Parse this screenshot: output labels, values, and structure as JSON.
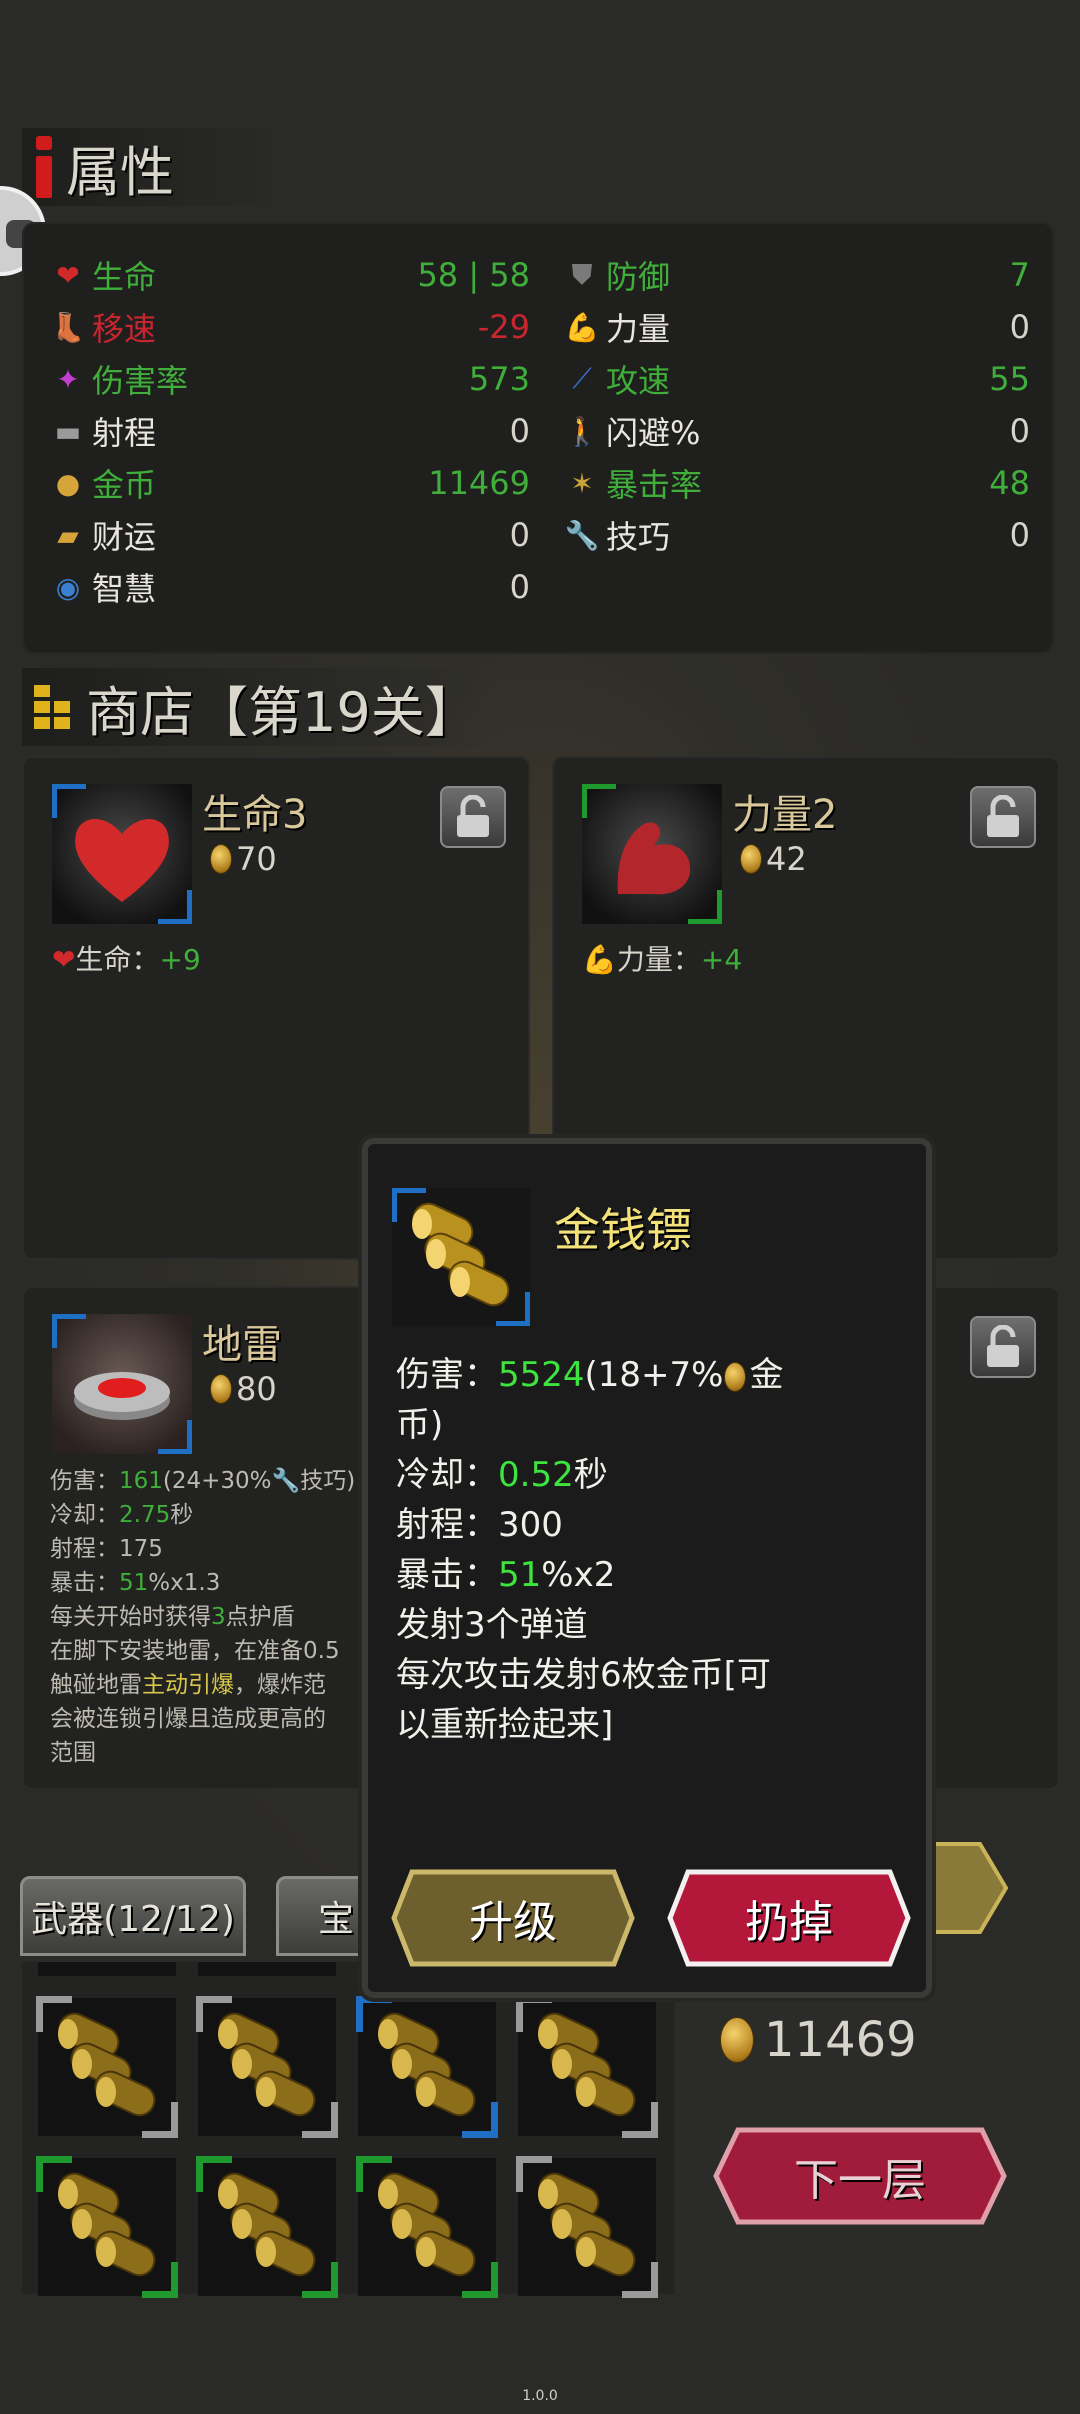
{
  "attributes": {
    "title": "属性",
    "stats_left": [
      {
        "icon": "heart-icon",
        "label": "生命",
        "value": "58 | 58",
        "color": "#3fae3a"
      },
      {
        "icon": "boot-icon",
        "label": "移速",
        "value": "-29",
        "color": "#c8262f"
      },
      {
        "icon": "sparkle-icon",
        "label": "伤害率",
        "value": "573",
        "color": "#3fae3a"
      },
      {
        "icon": "ruler-icon",
        "label": "射程",
        "value": "0",
        "color": "#d7d4cb"
      },
      {
        "icon": "coin-icon",
        "label": "金币",
        "value": "11469",
        "color": "#3fae3a"
      },
      {
        "icon": "gold-ingot-icon",
        "label": "财运",
        "value": "0",
        "color": "#d7d4cb"
      },
      {
        "icon": "brain-icon",
        "label": "智慧",
        "value": "0",
        "color": "#d7d4cb"
      }
    ],
    "stats_right": [
      {
        "icon": "shield-icon",
        "label": "防御",
        "value": "7",
        "color": "#3fae3a"
      },
      {
        "icon": "muscle-icon",
        "label": "力量",
        "value": "0",
        "color": "#d7d4cb"
      },
      {
        "icon": "feather-icon",
        "label": "攻速",
        "value": "55",
        "color": "#3fae3a"
      },
      {
        "icon": "dodge-figure-icon",
        "label": "闪避%",
        "value": "0",
        "color": "#d7d4cb"
      },
      {
        "icon": "crit-star-icon",
        "label": "暴击率",
        "value": "48",
        "color": "#3fae3a"
      },
      {
        "icon": "wrench-icon",
        "label": "技巧",
        "value": "0",
        "color": "#d7d4cb"
      }
    ]
  },
  "shop": {
    "title": "商店【第19关】",
    "cards": [
      {
        "name": "生命3",
        "cost": "70",
        "effect_label": "生命：",
        "effect_value": "+9"
      },
      {
        "name": "力量2",
        "cost": "42",
        "effect_label": "力量：",
        "effect_value": "+4"
      },
      {
        "name": "地雷",
        "cost": "80",
        "lines": [
          {
            "a": "伤害：",
            "b": "161",
            "c": "(24+30%",
            "d": "技巧)"
          },
          {
            "a": "冷却：",
            "b": "2.75",
            "c": "秒"
          },
          {
            "a": "射程：",
            "c": "175"
          },
          {
            "a": "暴击：",
            "b": "51",
            "c": "%x1.3"
          },
          {
            "a": "每关开始时获得",
            "b": "3",
            "c": "点护盾"
          },
          {
            "a": "在脚下安装地雷，在准备0.5"
          },
          {
            "a": "触碰地雷",
            "y": "主动引爆",
            "c": "，爆炸范"
          },
          {
            "a": "会被连锁引爆且造成更高的"
          },
          {
            "a": "范围"
          }
        ]
      }
    ]
  },
  "popup": {
    "name": "金钱镖",
    "damage_label": "伤害：",
    "damage_value": "5524",
    "damage_formula": "(18+7%",
    "damage_unit_a": "金",
    "damage_unit_b": "币)",
    "cooldown_label": "冷却：",
    "cooldown_value": "0.52",
    "cooldown_unit": "秒",
    "range_label": "射程：",
    "range_value": "300",
    "crit_label": "暴击：",
    "crit_value": "51",
    "crit_suffix": "%x2",
    "desc1": "发射3个弹道",
    "desc2a": "每次攻击发射6枚金币[可",
    "desc2b": "以重新捡起来]",
    "upgrade_label": "升级",
    "discard_label": "扔掉"
  },
  "tabs": {
    "weapons": "武器(12/12)",
    "second": "宝"
  },
  "gold": "11469",
  "next_floor": "下一层",
  "version": "1.0.0"
}
